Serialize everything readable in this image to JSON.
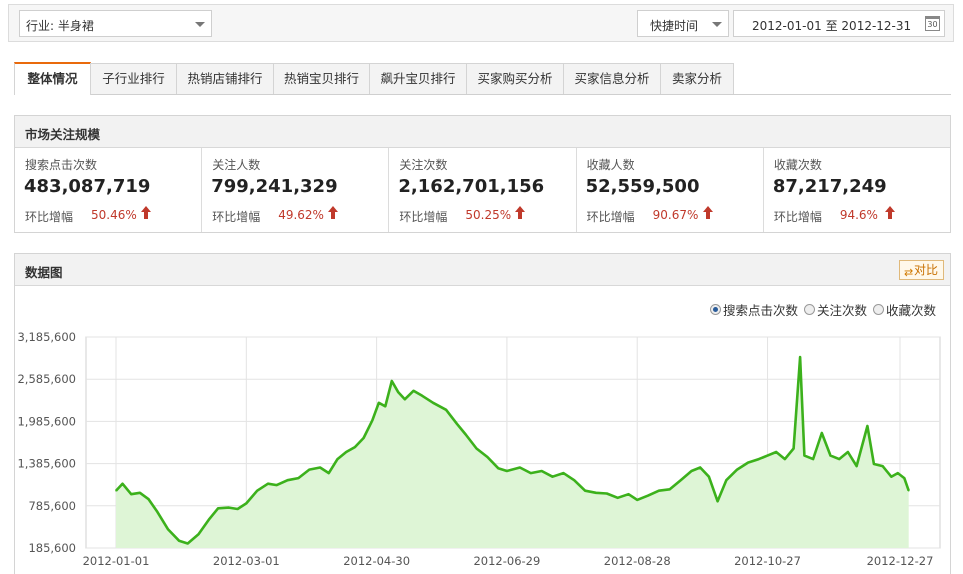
{
  "filters": {
    "industry_label": "行业: 半身裙",
    "quick_time_label": "快捷时间",
    "date_start": "2012-01-01",
    "date_sep": "至",
    "date_end": "2012-12-31",
    "calendar_icon_text": "30"
  },
  "tabs": [
    {
      "label": "整体情况",
      "active": true
    },
    {
      "label": "子行业排行",
      "active": false
    },
    {
      "label": "热销店铺排行",
      "active": false
    },
    {
      "label": "热销宝贝排行",
      "active": false
    },
    {
      "label": "飙升宝贝排行",
      "active": false
    },
    {
      "label": "买家购买分析",
      "active": false
    },
    {
      "label": "买家信息分析",
      "active": false
    },
    {
      "label": "卖家分析",
      "active": false
    }
  ],
  "market": {
    "title": "市场关注规模",
    "growth_label": "环比增幅",
    "metrics": [
      {
        "label": "搜索点击次数",
        "value": "483,087,719",
        "growth": "50.46%"
      },
      {
        "label": "关注人数",
        "value": "799,241,329",
        "growth": "49.62%"
      },
      {
        "label": "关注次数",
        "value": "2,162,701,156",
        "growth": "50.25%"
      },
      {
        "label": "收藏人数",
        "value": "52,559,500",
        "growth": "90.67%"
      },
      {
        "label": "收藏次数",
        "value": "87,217,249",
        "growth": "94.6%"
      }
    ],
    "up_color": "#c0392b"
  },
  "chart_panel": {
    "title": "数据图",
    "compare_label": "对比",
    "radios": [
      {
        "label": "搜索点击次数",
        "selected": true
      },
      {
        "label": "关注次数",
        "selected": false
      },
      {
        "label": "收藏次数",
        "selected": false
      }
    ]
  },
  "chart_data": {
    "type": "area",
    "series": [
      {
        "color": "#3cb11c",
        "fill": "#def5d6",
        "points": [
          [
            "2012-01-01",
            1000000
          ],
          [
            "2012-01-04",
            1100000
          ],
          [
            "2012-01-08",
            950000
          ],
          [
            "2012-01-12",
            970000
          ],
          [
            "2012-01-16",
            880000
          ],
          [
            "2012-01-20",
            700000
          ],
          [
            "2012-01-25",
            450000
          ],
          [
            "2012-01-30",
            290000
          ],
          [
            "2012-02-03",
            250000
          ],
          [
            "2012-02-08",
            380000
          ],
          [
            "2012-02-13",
            600000
          ],
          [
            "2012-02-17",
            750000
          ],
          [
            "2012-02-22",
            760000
          ],
          [
            "2012-02-26",
            740000
          ],
          [
            "2012-03-01",
            820000
          ],
          [
            "2012-03-06",
            1000000
          ],
          [
            "2012-03-11",
            1100000
          ],
          [
            "2012-03-15",
            1080000
          ],
          [
            "2012-03-20",
            1150000
          ],
          [
            "2012-03-25",
            1180000
          ],
          [
            "2012-03-30",
            1300000
          ],
          [
            "2012-04-04",
            1330000
          ],
          [
            "2012-04-08",
            1250000
          ],
          [
            "2012-04-12",
            1450000
          ],
          [
            "2012-04-16",
            1550000
          ],
          [
            "2012-04-20",
            1620000
          ],
          [
            "2012-04-24",
            1750000
          ],
          [
            "2012-04-28",
            2000000
          ],
          [
            "2012-05-01",
            2250000
          ],
          [
            "2012-05-04",
            2200000
          ],
          [
            "2012-05-07",
            2560000
          ],
          [
            "2012-05-10",
            2400000
          ],
          [
            "2012-05-13",
            2300000
          ],
          [
            "2012-05-17",
            2420000
          ],
          [
            "2012-05-21",
            2350000
          ],
          [
            "2012-05-26",
            2250000
          ],
          [
            "2012-06-01",
            2150000
          ],
          [
            "2012-06-06",
            1950000
          ],
          [
            "2012-06-10",
            1800000
          ],
          [
            "2012-06-15",
            1600000
          ],
          [
            "2012-06-20",
            1480000
          ],
          [
            "2012-06-25",
            1320000
          ],
          [
            "2012-06-29",
            1280000
          ],
          [
            "2012-07-05",
            1330000
          ],
          [
            "2012-07-10",
            1250000
          ],
          [
            "2012-07-15",
            1280000
          ],
          [
            "2012-07-20",
            1200000
          ],
          [
            "2012-07-25",
            1250000
          ],
          [
            "2012-07-30",
            1150000
          ],
          [
            "2012-08-04",
            1000000
          ],
          [
            "2012-08-09",
            970000
          ],
          [
            "2012-08-14",
            960000
          ],
          [
            "2012-08-19",
            900000
          ],
          [
            "2012-08-24",
            950000
          ],
          [
            "2012-08-28",
            870000
          ],
          [
            "2012-09-02",
            930000
          ],
          [
            "2012-09-07",
            1000000
          ],
          [
            "2012-09-12",
            1020000
          ],
          [
            "2012-09-17",
            1150000
          ],
          [
            "2012-09-22",
            1280000
          ],
          [
            "2012-09-26",
            1330000
          ],
          [
            "2012-09-30",
            1200000
          ],
          [
            "2012-10-04",
            850000
          ],
          [
            "2012-10-08",
            1150000
          ],
          [
            "2012-10-13",
            1300000
          ],
          [
            "2012-10-18",
            1400000
          ],
          [
            "2012-10-23",
            1450000
          ],
          [
            "2012-10-27",
            1500000
          ],
          [
            "2012-10-31",
            1550000
          ],
          [
            "2012-11-04",
            1450000
          ],
          [
            "2012-11-08",
            1600000
          ],
          [
            "2012-11-11",
            2900000
          ],
          [
            "2012-11-13",
            1500000
          ],
          [
            "2012-11-17",
            1450000
          ],
          [
            "2012-11-21",
            1820000
          ],
          [
            "2012-11-25",
            1500000
          ],
          [
            "2012-11-29",
            1450000
          ],
          [
            "2012-12-03",
            1550000
          ],
          [
            "2012-12-07",
            1350000
          ],
          [
            "2012-12-12",
            1920000
          ],
          [
            "2012-12-15",
            1380000
          ],
          [
            "2012-12-19",
            1350000
          ],
          [
            "2012-12-23",
            1200000
          ],
          [
            "2012-12-26",
            1250000
          ],
          [
            "2012-12-29",
            1180000
          ],
          [
            "2012-12-31",
            1000000
          ]
        ]
      }
    ],
    "yticks": [
      "185,600",
      "785,600",
      "1,385,600",
      "1,985,600",
      "2,585,600",
      "3,185,600"
    ],
    "ylim": [
      185600,
      3185600
    ],
    "xticks": [
      "2012-01-01",
      "2012-03-01",
      "2012-04-30",
      "2012-06-29",
      "2012-08-28",
      "2012-10-27",
      "2012-12-27"
    ],
    "xlim": [
      "2012-01-01",
      "2012-12-31"
    ],
    "grid": true
  }
}
